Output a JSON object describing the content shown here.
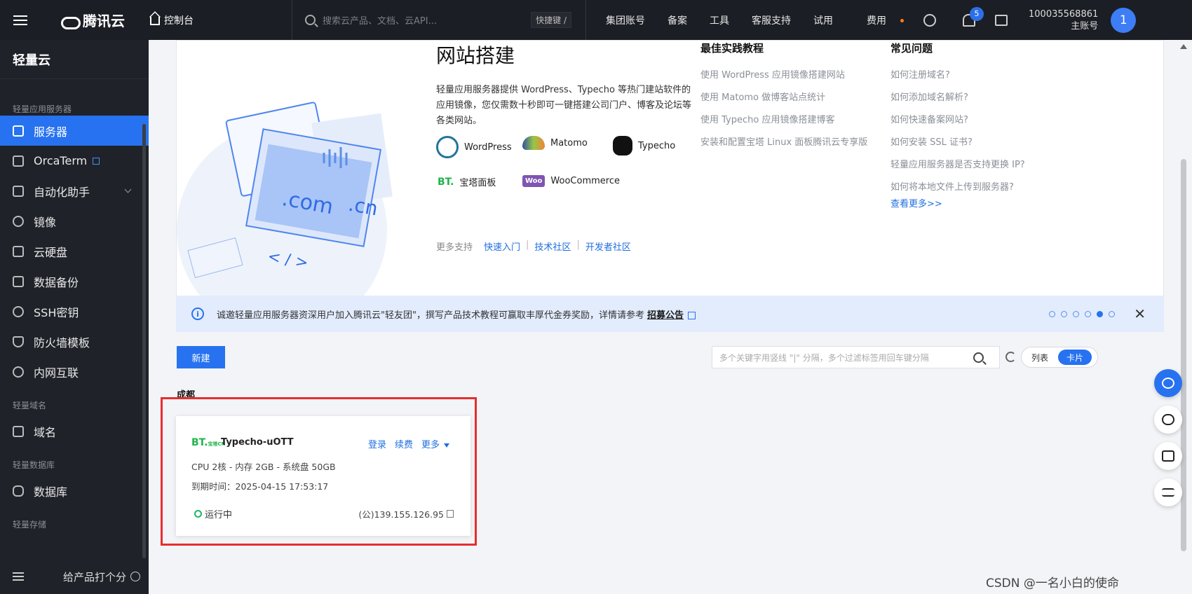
{
  "topbar": {
    "brand": "腾讯云",
    "console": "控制台",
    "search_placeholder": "搜索云产品、文档、云API...",
    "shortcut": "快捷键 /",
    "nav": [
      "集团账号",
      "备案",
      "工具",
      "客服支持",
      "试用",
      "费用"
    ],
    "notif_count": "5",
    "account_id": "100035568861",
    "account_role": "主账号",
    "avatar": "1"
  },
  "sidebar": {
    "title": "轻量云",
    "sections": [
      {
        "label": "轻量应用服务器"
      },
      {
        "label": "轻量域名"
      },
      {
        "label": "轻量数据库"
      },
      {
        "label": "轻量存储"
      }
    ],
    "items": [
      {
        "label": "服务器",
        "icon": "cube-icon",
        "active": true
      },
      {
        "label": "OrcaTerm",
        "icon": "terminal-icon"
      },
      {
        "label": "自动化助手",
        "icon": "robot-icon"
      },
      {
        "label": "镜像",
        "icon": "image-icon"
      },
      {
        "label": "云硬盘",
        "icon": "disk-icon"
      },
      {
        "label": "数据备份",
        "icon": "backup-icon"
      },
      {
        "label": "SSH密钥",
        "icon": "key-icon"
      },
      {
        "label": "防火墙模板",
        "icon": "shield-icon"
      },
      {
        "label": "内网互联",
        "icon": "network-icon"
      },
      {
        "label": "域名",
        "icon": "domain-icon"
      },
      {
        "label": "数据库",
        "icon": "database-icon"
      }
    ],
    "footer": "给产品打个分"
  },
  "banner": {
    "title": "网站搭建",
    "desc": "轻量应用服务器提供 WordPress、Typecho 等热门建站软件的应用镜像，您仅需数十秒即可一键搭建公司门户、博客及论坛等各类网站。",
    "apps": [
      "WordPress",
      "Matomo",
      "Typecho",
      "宝塔面板",
      "WooCommerce"
    ],
    "more_support_label": "更多支持",
    "more_support_links": [
      "快速入门",
      "技术社区",
      "开发者社区"
    ],
    "best_practice_title": "最佳实践教程",
    "best_practice": [
      "使用 WordPress 应用镜像搭建网站",
      "使用 Matomo 做博客站点统计",
      "使用 Typecho 应用镜像搭建博客",
      "安装和配置宝塔 Linux 面板腾讯云专享版"
    ],
    "faq_title": "常见问题",
    "faq": [
      "如何注册域名?",
      "如何添加域名解析?",
      "如何快速备案网站?",
      "如何安装 SSL 证书?",
      "轻量应用服务器是否支持更换 IP?",
      "如何将本地文件上传到服务器?"
    ],
    "view_more": "查看更多>>",
    "illus_com": ".com",
    "illus_cn": ".cn",
    "illus_code": "< / >"
  },
  "notice": {
    "text": "诚邀轻量应用服务器资深用户加入腾讯云\"轻友团\"，撰写产品技术教程可赢取丰厚代金券奖励，详情请参考",
    "link": "招募公告",
    "close": "✕"
  },
  "toolbar": {
    "new_button": "新建",
    "filter_placeholder": "多个关键字用竖线 \"|\" 分隔，多个过滤标签用回车键分隔",
    "view_list": "列表",
    "view_card": "卡片"
  },
  "region": "成都",
  "instance": {
    "logo_text": "BT.",
    "logo_small": "宝塔CN",
    "name": "Typecho-uOTT",
    "actions": [
      "登录",
      "续费",
      "更多"
    ],
    "spec": "CPU 2核 - 内存 2GB - 系统盘 50GB",
    "expire": "到期时间：2025-04-15 17:53:17",
    "status": "运行中",
    "ip": "(公)139.155.126.95"
  },
  "watermark": "CSDN @一名小白的使命"
}
